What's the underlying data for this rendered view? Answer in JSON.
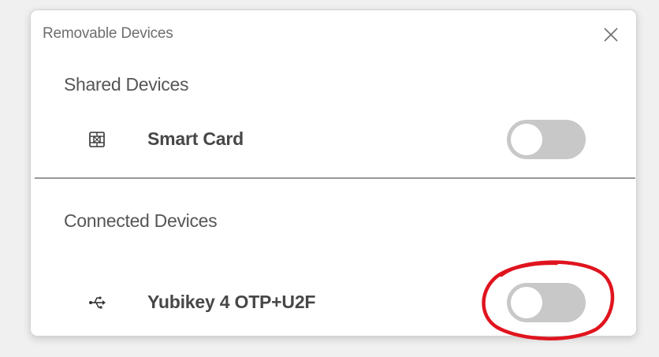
{
  "dialog": {
    "title": "Removable Devices",
    "close_icon": "close-icon"
  },
  "sections": {
    "shared": {
      "title": "Shared Devices",
      "devices": [
        {
          "name": "Smart Card",
          "icon": "smart-card-icon",
          "enabled": false
        }
      ]
    },
    "connected": {
      "title": "Connected Devices",
      "devices": [
        {
          "name": "Yubikey 4 OTP+U2F",
          "icon": "usb-icon",
          "enabled": false
        }
      ]
    }
  },
  "annotation": {
    "color": "#e0141e",
    "target": "yubikey-toggle"
  },
  "colors": {
    "toggle_off": "#c8c8c8",
    "divider": "#999999"
  }
}
